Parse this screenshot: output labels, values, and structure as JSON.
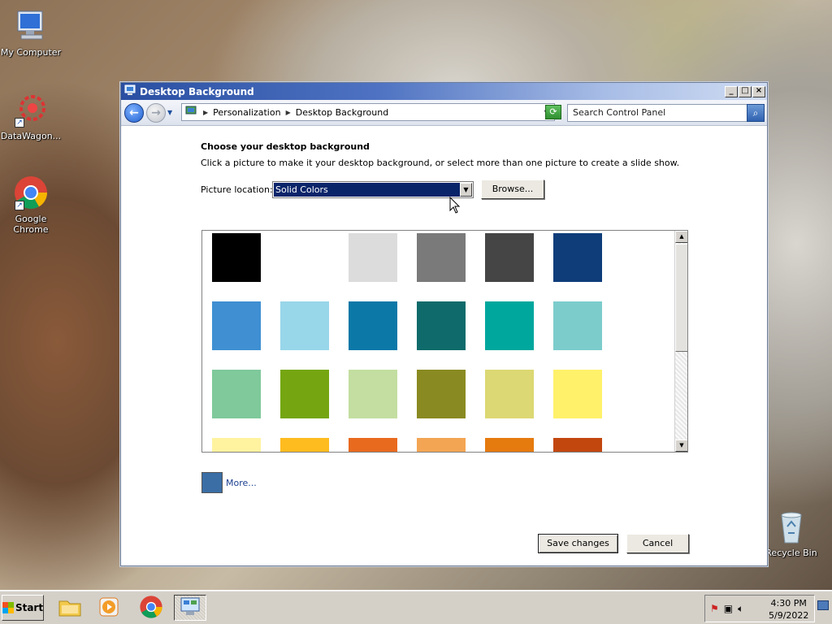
{
  "desktop": {
    "icons": [
      {
        "label": "My Computer"
      },
      {
        "label": "DataWagon..."
      },
      {
        "label": "Google Chrome"
      },
      {
        "label": "Recycle Bin"
      }
    ]
  },
  "window": {
    "title": "Desktop Background",
    "controls": {
      "minimize": "_",
      "maximize": "□",
      "close": "×"
    },
    "address": {
      "crumbs": [
        "Personalization",
        "Desktop Background"
      ],
      "search_placeholder": "Search Control Panel"
    },
    "content": {
      "heading": "Choose your desktop background",
      "instruction": "Click a picture to make it your desktop background, or select more than one picture to create a slide show.",
      "picture_location_label": "Picture location:",
      "picture_location_value": "Solid Colors",
      "browse_label": "Browse...",
      "more_label": "More...",
      "more_color": "#3a6ea5",
      "save_label": "Save changes",
      "cancel_label": "Cancel"
    },
    "swatches": [
      "#000000",
      "#ffffff",
      "#dcdcdc",
      "#7a7a7a",
      "#454545",
      "#0f3d7a",
      "#3f8fd2",
      "#98d6ea",
      "#0b78a8",
      "#0f6b6b",
      "#00a79d",
      "#7ccccc",
      "#7fc99b",
      "#75a612",
      "#c3dea0",
      "#8a8a22",
      "#dcd873",
      "#fff16a",
      "#fff3a0",
      "#ffbc1f",
      "#e86a1f",
      "#f3a553",
      "#e57a0f",
      "#c2470f"
    ]
  },
  "taskbar": {
    "start_label": "Start",
    "clock_time": "4:30 PM",
    "clock_date": "5/9/2022"
  }
}
